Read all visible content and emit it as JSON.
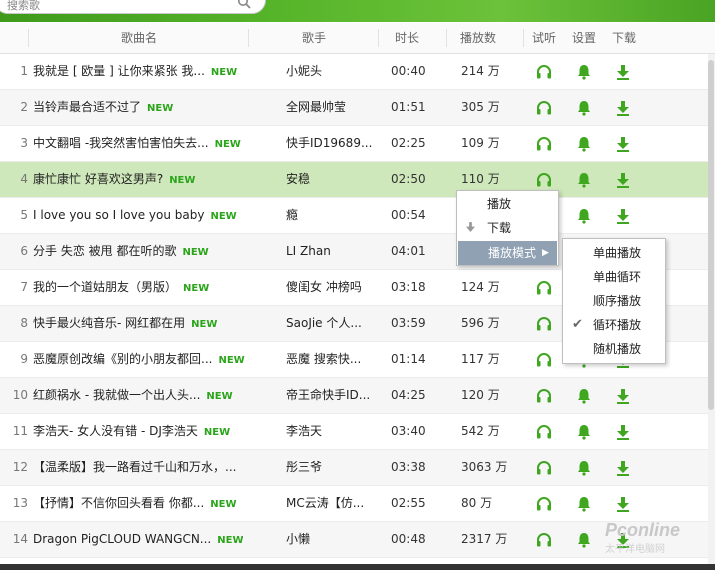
{
  "search": {
    "placeholder": "搜索歌"
  },
  "columns": {
    "title": "歌曲名",
    "singer": "歌手",
    "duration": "时长",
    "plays": "播放数",
    "listen": "试听",
    "settings": "设置",
    "download": "下载"
  },
  "songs": [
    {
      "num": "1",
      "title": "我就是 [ 欧量 ] 让你来紧张  我...",
      "new": "NEW",
      "singer": "小妮头",
      "duration": "00:40",
      "plays": "214 万"
    },
    {
      "num": "2",
      "title": "当铃声最合适不过了",
      "new": "NEW",
      "singer": "全网最帅莹",
      "duration": "01:51",
      "plays": "305 万"
    },
    {
      "num": "3",
      "title": "中文翻唱 -我突然害怕害怕失去...",
      "new": "NEW",
      "singer": "快手ID19689...",
      "duration": "02:25",
      "plays": "109 万"
    },
    {
      "num": "4",
      "title": "康忙康忙 好喜欢这男声?",
      "new": "NEW",
      "singer": "安稳",
      "duration": "02:50",
      "plays": "110 万"
    },
    {
      "num": "5",
      "title": "I love you so I love you baby",
      "new": "NEW",
      "singer": "瘾",
      "duration": "00:54",
      "plays": ""
    },
    {
      "num": "6",
      "title": "分手  失恋  被甩  都在听的歌",
      "new": "NEW",
      "singer": "LI  Zhan",
      "duration": "04:01",
      "plays": ""
    },
    {
      "num": "7",
      "title": "我的一个道姑朋友（男版）",
      "new": "NEW",
      "singer": "傻闺女  冲榜吗",
      "duration": "03:18",
      "plays": "124 万"
    },
    {
      "num": "8",
      "title": "快手最火纯音乐- 网红都在用",
      "new": "NEW",
      "singer": "SaoJie  个人...",
      "duration": "03:59",
      "plays": "596 万"
    },
    {
      "num": "9",
      "title": "恶魔原创改编《别的小朋友都回...",
      "new": "NEW",
      "singer": "恶魔   搜索快...",
      "duration": "01:14",
      "plays": "117 万"
    },
    {
      "num": "10",
      "title": "红颜祸水  -  我就做一个出人头...",
      "new": "NEW",
      "singer": "帝王命快手ID...",
      "duration": "04:25",
      "plays": "120 万"
    },
    {
      "num": "11",
      "title": "李浩天- 女人没有错  - DJ李浩天",
      "new": "NEW",
      "singer": "李浩天",
      "duration": "03:40",
      "plays": "542 万"
    },
    {
      "num": "12",
      "title": "【温柔版】我一路看过千山和万水，...",
      "new": "",
      "singer": "彤三爷",
      "duration": "03:38",
      "plays": "3063 万"
    },
    {
      "num": "13",
      "title": "【抒情】不信你回头看看  你都...",
      "new": "NEW",
      "singer": "MC云涛【仿...",
      "duration": "02:55",
      "plays": "80 万"
    },
    {
      "num": "14",
      "title": "Dragon PigCLOUD WANGCN...",
      "new": "NEW",
      "singer": "小懒",
      "duration": "00:48",
      "plays": "2317 万"
    }
  ],
  "context_menu": {
    "play": "播放",
    "download": "下载",
    "play_mode": "播放模式"
  },
  "play_mode_menu": {
    "items": [
      "单曲播放",
      "单曲循环",
      "顺序播放",
      "循环播放",
      "随机播放"
    ],
    "checked_mark": "✔"
  },
  "watermark": {
    "logo": "Pconline",
    "sub": "太平洋电脑网"
  },
  "colors": {
    "accent": "#2aa51a",
    "highlight_row": "#cfe8bb",
    "menu_active": "#8fa1b3"
  }
}
